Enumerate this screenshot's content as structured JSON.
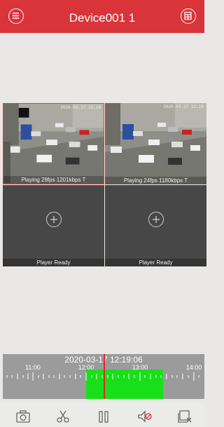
{
  "header": {
    "title": "Device001 1",
    "menu_icon": "menu-icon",
    "layout_icon": "window-layout-icon",
    "color": "#d8343a"
  },
  "players": [
    {
      "status": "Playing 29fps 1201kbps T",
      "osd": "2020-03-17 12:18",
      "state": "playing",
      "selected": true
    },
    {
      "status": "Playing 24fps 1180kbps T",
      "osd": "2020-03-17 12:18",
      "state": "playing",
      "selected": false
    },
    {
      "status": "Player Ready",
      "state": "ready"
    },
    {
      "status": "Player Ready",
      "state": "ready"
    }
  ],
  "timeline": {
    "datetime": "2020-03-17 12:19:06",
    "ticks": [
      "11:00",
      "12:00",
      "13:00",
      "14:00"
    ],
    "record_color": "#18e018",
    "cursor_color": "#e2242b"
  },
  "toolbar": {
    "icons": [
      "camera-icon",
      "scissors-icon",
      "pause-icon",
      "mute-icon",
      "close-all-icon"
    ]
  }
}
